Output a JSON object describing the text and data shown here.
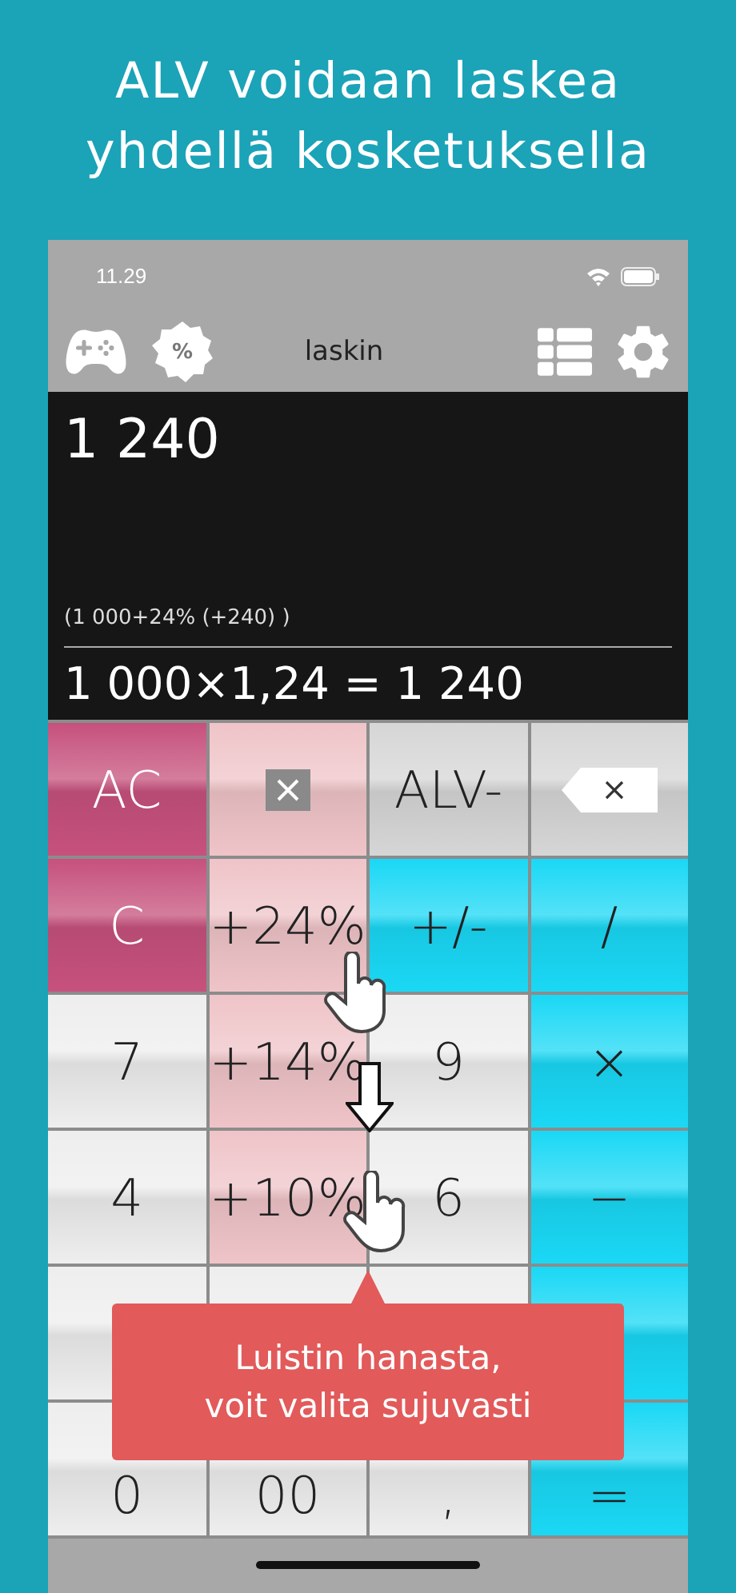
{
  "headline": [
    "ALV voidaan laskea",
    "yhdellä kosketuksella"
  ],
  "status_bar": {
    "time": "11.29"
  },
  "toolbar": {
    "title": "laskin",
    "badge_label": "%"
  },
  "display": {
    "result": "1 240",
    "detail": "(1 000+24% (+240) )",
    "equation": "1 000×1,24 = 1 240"
  },
  "keys": [
    {
      "kind": "text",
      "color": "#c6517c",
      "label": "AC"
    },
    {
      "kind": "clear-box",
      "color": "#efc4c8"
    },
    {
      "kind": "text",
      "color": "#d6d6d6",
      "label": "ALV-"
    },
    {
      "kind": "backspace",
      "color": "#d6d6d6"
    },
    {
      "kind": "text",
      "color": "#c6517c",
      "label": "C"
    },
    {
      "kind": "text",
      "color": "#efc4c8",
      "label": "+24%"
    },
    {
      "kind": "text",
      "color": "#1ad8f5",
      "label": "+/-"
    },
    {
      "kind": "text",
      "color": "#1ad8f5",
      "label": "/"
    },
    {
      "kind": "text",
      "color": "#eeeeee",
      "label": "7"
    },
    {
      "kind": "text",
      "color": "#efc4c8",
      "label": "+14%"
    },
    {
      "kind": "text",
      "color": "#eeeeee",
      "label": "9"
    },
    {
      "kind": "text",
      "color": "#1ad8f5",
      "label": "×"
    },
    {
      "kind": "text",
      "color": "#eeeeee",
      "label": "4"
    },
    {
      "kind": "text",
      "color": "#efc4c8",
      "label": "+10%"
    },
    {
      "kind": "text",
      "color": "#eeeeee",
      "label": "6"
    },
    {
      "kind": "text",
      "color": "#1ad8f5",
      "label": "−"
    },
    {
      "kind": "blank",
      "color": "#eeeeee"
    },
    {
      "kind": "blank",
      "color": "#eeeeee"
    },
    {
      "kind": "blank",
      "color": "#eeeeee"
    },
    {
      "kind": "blank",
      "color": "#1ad8f5"
    },
    {
      "kind": "text",
      "color": "#eeeeee",
      "label": "0"
    },
    {
      "kind": "text",
      "color": "#eeeeee",
      "label": "00"
    },
    {
      "kind": "text",
      "color": "#eeeeee",
      "label": ","
    },
    {
      "kind": "text",
      "color": "#1ad8f5",
      "label": "="
    }
  ],
  "tooltip": {
    "lines": [
      "Luistin hanasta,",
      "voit valita sujuvasti"
    ]
  }
}
